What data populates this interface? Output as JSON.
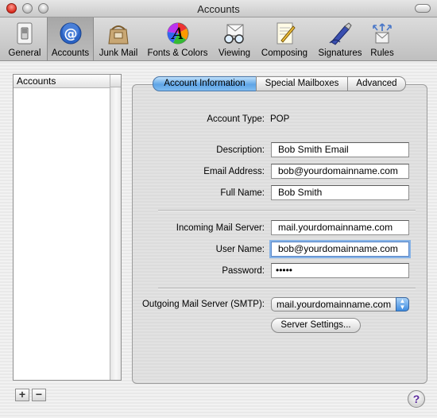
{
  "window": {
    "title": "Accounts"
  },
  "toolbar": {
    "items": [
      {
        "label": "General"
      },
      {
        "label": "Accounts"
      },
      {
        "label": "Junk Mail"
      },
      {
        "label": "Fonts & Colors"
      },
      {
        "label": "Viewing"
      },
      {
        "label": "Composing"
      },
      {
        "label": "Signatures"
      },
      {
        "label": "Rules"
      }
    ],
    "selected": "Accounts"
  },
  "account_list": {
    "header": "Accounts",
    "add_label": "+",
    "remove_label": "−"
  },
  "tabs": [
    {
      "label": "Account Information"
    },
    {
      "label": "Special Mailboxes"
    },
    {
      "label": "Advanced"
    }
  ],
  "form": {
    "account_type_label": "Account Type:",
    "account_type_value": "POP",
    "description_label": "Description:",
    "description_value": "Bob Smith Email",
    "email_label": "Email Address:",
    "email_value": "bob@yourdomainname.com",
    "full_name_label": "Full Name:",
    "full_name_value": "Bob Smith",
    "incoming_label": "Incoming Mail Server:",
    "incoming_value": "mail.yourdomainname.com",
    "user_name_label": "User Name:",
    "user_name_value": "bob@yourdomainname.com",
    "password_label": "Password:",
    "password_value": "•••••",
    "outgoing_label": "Outgoing Mail Server (SMTP):",
    "outgoing_value": "mail.yourdomainname.com",
    "server_settings_label": "Server Settings..."
  },
  "help": {
    "label": "?"
  },
  "colors": {
    "accent": "#5fa5e6",
    "selected_toolbar": "#a7a7a7"
  }
}
